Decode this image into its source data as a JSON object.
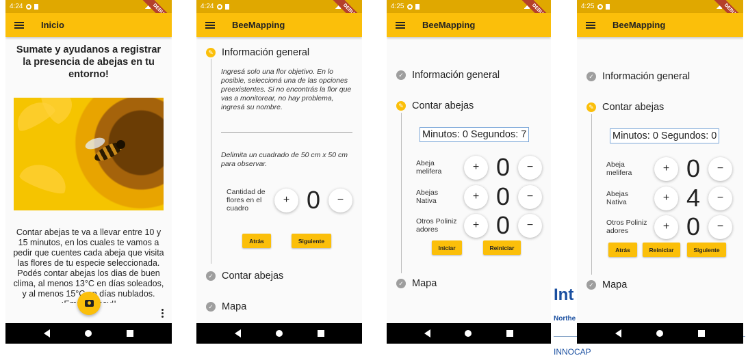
{
  "status": {
    "time_a": "4:24",
    "time_b": "4:25",
    "debug": "DEBUG"
  },
  "phone1": {
    "appbar_title": "Inicio",
    "headline": "Sumate y ayudanos a registrar la presencia de abejas en tu entorno!",
    "body": "Contar abejas te va a llevar entre 10 y 15 minutos, en los cuales te vamos a pedir que cuentes cada abeja que visita las flores de tu especie seleccionada. Podés contar abejas los dias de buen clima, al menos 13°C en días soleados, y al menos 15°C en días nublados. ¡Empezá hoy!!"
  },
  "phone2": {
    "appbar_title": "BeeMapping",
    "step1": "Información general",
    "instr1": "Ingresá solo una flor objetivo. En lo posible, seleccioná una de las opciones preexistentes. Si no encontrás la flor que vas a monitorear, no hay problema, ingresá su nombre.",
    "instr2": "Delimita un cuadrado de 50 cm x 50 cm para observar.",
    "counter_label": "Cantidad de flores en el cuadro",
    "counter_value": "0",
    "plus": "+",
    "minus": "−",
    "back": "Atrás",
    "next": "Siguiente",
    "step2": "Contar abejas",
    "step3": "Mapa"
  },
  "phone3": {
    "appbar_title": "BeeMapping",
    "step1": "Información general",
    "step2": "Contar abejas",
    "timer": "Minutos: 0 Segundos: 7",
    "rows": [
      {
        "label": "Abeja melifera",
        "value": "0"
      },
      {
        "label": "Abejas Nativa",
        "value": "0"
      },
      {
        "label": "Otros Polinizadores",
        "value": "0"
      }
    ],
    "start": "Iniciar",
    "reset": "Reiniciar",
    "step3": "Mapa"
  },
  "phone4": {
    "appbar_title": "BeeMapping",
    "step1": "Información general",
    "step2": "Contar abejas",
    "timer": "Minutos: 0 Segundos: 0",
    "rows": [
      {
        "label": "Abeja melifera",
        "value": "0"
      },
      {
        "label": "Abejas Nativa",
        "value": "4"
      },
      {
        "label": "Otros Polinizadores",
        "value": "0"
      }
    ],
    "back": "Atrás",
    "reset": "Reiniciar",
    "next": "Siguiente",
    "step3": "Mapa"
  },
  "background": {
    "fragment_a": "Int",
    "fragment_b": "Northe",
    "fragment_c": "INNOCAP"
  }
}
